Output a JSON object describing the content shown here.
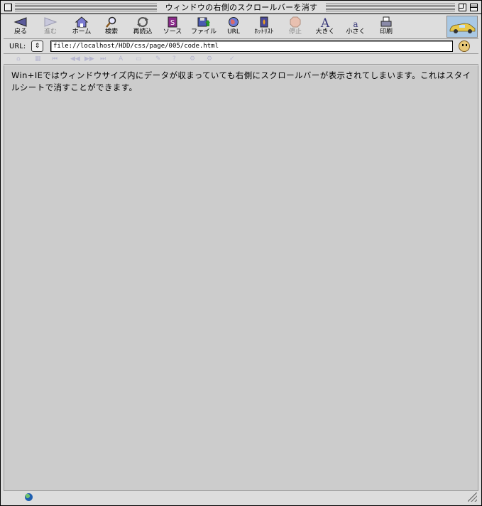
{
  "window": {
    "title": "ウィンドウの右側のスクロールバーを消す"
  },
  "toolbar": {
    "buttons": [
      {
        "id": "back",
        "label": "戻る",
        "icon": "back-arrow-icon",
        "enabled": true
      },
      {
        "id": "forward",
        "label": "進む",
        "icon": "forward-arrow-icon",
        "enabled": false
      },
      {
        "id": "home",
        "label": "ホーム",
        "icon": "home-icon",
        "enabled": true
      },
      {
        "id": "search",
        "label": "検索",
        "icon": "magnifier-icon",
        "enabled": true
      },
      {
        "id": "reload",
        "label": "再読込",
        "icon": "reload-icon",
        "enabled": true
      },
      {
        "id": "source",
        "label": "ソース",
        "icon": "source-icon",
        "enabled": true
      },
      {
        "id": "file",
        "label": "ファイル",
        "icon": "file-save-icon",
        "enabled": true
      },
      {
        "id": "url",
        "label": "URL",
        "icon": "globe-icon",
        "enabled": true
      },
      {
        "id": "hotlist",
        "label": "ﾎｯﾄﾘｽﾄ",
        "icon": "hotlist-icon",
        "enabled": true
      },
      {
        "id": "stop",
        "label": "停止",
        "icon": "stop-icon",
        "enabled": false
      },
      {
        "id": "bigger",
        "label": "大きく",
        "icon": "font-larger-icon",
        "enabled": true
      },
      {
        "id": "smaller",
        "label": "小さく",
        "icon": "font-smaller-icon",
        "enabled": true
      },
      {
        "id": "print",
        "label": "印刷",
        "icon": "printer-icon",
        "enabled": true
      }
    ]
  },
  "urlbar": {
    "label": "URL:",
    "value": "file://localhost/HDD/css/page/005/code.html"
  },
  "content": {
    "text": "Win+IEではウィンドウサイズ内にデータが収まっていても右側にスクロールバーが表示されてしまいます。これはスタイルシートで消すことができます。"
  },
  "colors": {
    "content_bg": "#cccccc",
    "chrome_bg": "#dddddd",
    "brand_bg": "#a9c8e4"
  }
}
